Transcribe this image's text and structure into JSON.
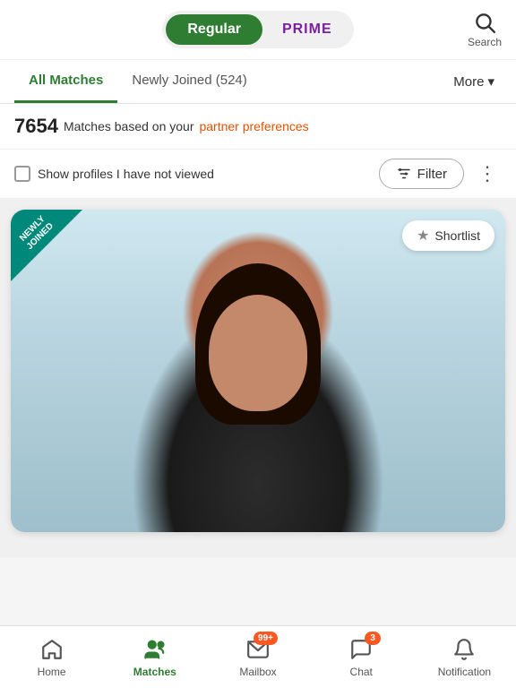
{
  "header": {
    "toggle_regular": "Regular",
    "toggle_prime": "PRIME",
    "search_label": "Search"
  },
  "tabs": {
    "items": [
      {
        "id": "all-matches",
        "label": "All Matches",
        "active": true
      },
      {
        "id": "newly-joined",
        "label": "Newly Joined (524)",
        "active": false
      }
    ],
    "more_label": "More"
  },
  "matches_bar": {
    "count": "7654",
    "text": "Matches based on your",
    "pref_link": "partner preferences"
  },
  "filter_bar": {
    "checkbox_label": "Show profiles I have not viewed",
    "filter_label": "Filter",
    "dots": "⋮"
  },
  "profile_card": {
    "newly_joined_line1": "NEWLY",
    "newly_joined_line2": "JOINED",
    "shortlist_label": "Shortlist"
  },
  "bottom_nav": {
    "items": [
      {
        "id": "home",
        "label": "Home",
        "active": false,
        "badge": null
      },
      {
        "id": "matches",
        "label": "Matches",
        "active": true,
        "badge": null
      },
      {
        "id": "mailbox",
        "label": "Mailbox",
        "active": false,
        "badge": "99+"
      },
      {
        "id": "chat",
        "label": "Chat",
        "active": false,
        "badge": "3"
      },
      {
        "id": "notification",
        "label": "Notification",
        "active": false,
        "badge": null
      }
    ]
  }
}
